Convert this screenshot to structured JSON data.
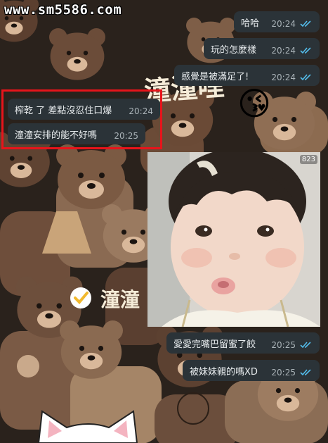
{
  "watermark": "www.sm5586.com",
  "wallpaper": {
    "banner_text": "潼潼哩",
    "sticker_text": "潼潼",
    "kiss_emoji": "😘",
    "check_icon": "check-circle-icon"
  },
  "messages": {
    "m1": {
      "text": "哈哈",
      "time": "20:24",
      "read": true
    },
    "m2": {
      "text": "玩的怎麼樣",
      "time": "20:24",
      "read": true
    },
    "m3": {
      "text": "感覺是被滿足了!",
      "time": "20:24",
      "read": true
    },
    "m4": {
      "text": "榨乾 了 差點沒忍住口爆",
      "time": "20:24"
    },
    "m5": {
      "text": "潼潼安排的能不好嗎",
      "time": "20:25"
    },
    "m6": {
      "text": "愛愛完嘴巴留蜜了餃",
      "time": "20:25",
      "read": true
    },
    "m7": {
      "text": "被妹妹親的嗎XD",
      "time": "20:25",
      "read": true
    }
  },
  "photo": {
    "badge": "823"
  },
  "colors": {
    "bubble_bg": "#2b3338",
    "read_tick": "#53bdeb",
    "highlight": "#e8141b",
    "wallpaper_bg": "#2a221c"
  }
}
